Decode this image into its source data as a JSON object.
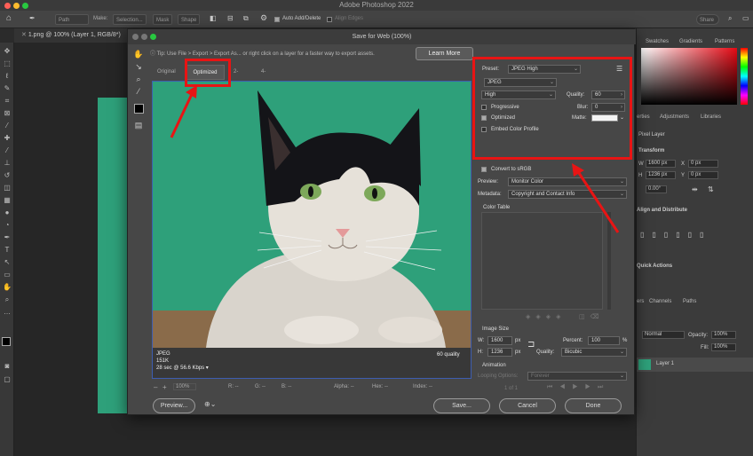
{
  "app": {
    "title": "Adobe Photoshop 2022"
  },
  "optionsbar": {
    "path_label": "Path",
    "make_label": "Make:",
    "selection_label": "Selection...",
    "mask_label": "Mask",
    "shape_label": "Shape",
    "auto_add_label": "Auto Add/Delete",
    "align_edges_label": "Align Edges",
    "share_label": "Share"
  },
  "document": {
    "tab": "1.png @ 100% (Layer 1, RGB/8*)"
  },
  "rightpanel": {
    "tabs": [
      "Swatches",
      "Gradients",
      "Patterns"
    ],
    "tabs2": [
      "erties",
      "Adjustments",
      "Libraries"
    ],
    "pixel_layer": "Pixel Layer",
    "transform": "Transform",
    "w_label": "W",
    "w_value": "1600 px",
    "x_label": "X",
    "x_value": "0 px",
    "h_label": "H",
    "h_value": "1236 px",
    "y_label": "Y",
    "y_value": "0 px",
    "angle_value": "0.00°",
    "align_label": "Align and Distribute",
    "quick_actions": "Quick Actions",
    "layers_tabs": [
      "ers",
      "Channels",
      "Paths"
    ],
    "normal_label": "Normal",
    "opacity_label": "Opacity:",
    "opacity_value": "100%",
    "fill_label": "Fill:",
    "fill_value": "100%",
    "layer_name": "Layer 1"
  },
  "dialog": {
    "title": "Save for Web (100%)",
    "tip": "Tip: Use File > Export > Export As... or right click on a layer for a faster way to export assets.",
    "learn_more": "Learn More",
    "view_tabs": [
      "Original",
      "Optimized",
      "2-Up",
      "4-Up"
    ],
    "preview_info": {
      "format": "JPEG",
      "size": "151K",
      "time": "28 sec @ 56.6 Kbps",
      "quality": "60 quality"
    },
    "bottom": {
      "zoom": "100%",
      "r_label": "R:",
      "g_label": "G:",
      "b_label": "B:",
      "alpha_label": "Alpha:",
      "hex_label": "Hex:",
      "index_label": "Index:",
      "r": "--",
      "g": "--",
      "b": "--",
      "alpha": "--",
      "hex": "--",
      "index": "--"
    },
    "settings": {
      "preset_label": "Preset:",
      "preset_value": "JPEG High",
      "format_value": "JPEG",
      "quality_level": "High",
      "quality_label": "Quality:",
      "quality_value": "60",
      "progressive_label": "Progressive",
      "blur_label": "Blur:",
      "blur_value": "0",
      "optimized_label": "Optimized",
      "matte_label": "Matte:",
      "embed_label": "Embed Color Profile",
      "srgb_label": "Convert to sRGB",
      "preview_label": "Preview:",
      "preview_value": "Monitor Color",
      "metadata_label": "Metadata:",
      "metadata_value": "Copyright and Contact Info",
      "color_table_label": "Color Table",
      "image_size_label": "Image Size",
      "w_label": "W:",
      "w_value": "1600",
      "h_label": "H:",
      "h_value": "1236",
      "px": "px",
      "percent_label": "Percent:",
      "percent_value": "100",
      "percent_unit": "%",
      "quality2_label": "Quality:",
      "quality2_value": "Bicubic",
      "animation_label": "Animation",
      "looping_label": "Looping Options:",
      "looping_value": "Forever",
      "frame_count": "1 of 1"
    },
    "buttons": {
      "preview": "Preview...",
      "save": "Save...",
      "cancel": "Cancel",
      "done": "Done"
    }
  },
  "colors": {
    "annotation": "#e81414",
    "teal_bg": "#2ea07a",
    "selection_blue": "#3d5db0"
  }
}
